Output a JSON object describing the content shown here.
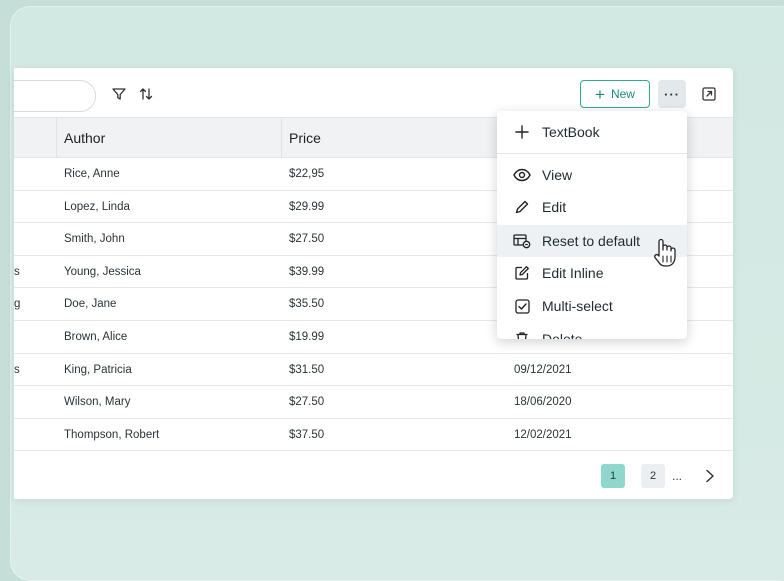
{
  "toolbar": {
    "new_label": "New",
    "more_label": "···"
  },
  "table": {
    "columns": [
      "Author",
      "Price"
    ],
    "rows": [
      {
        "lead": "",
        "author": "Rice, Anne",
        "price": "$22,95",
        "date": ""
      },
      {
        "lead": "",
        "author": "Lopez, Linda",
        "price": "$29.99",
        "date": ""
      },
      {
        "lead": "",
        "author": "Smith, John",
        "price": "$27.50",
        "date": ""
      },
      {
        "lead": "s",
        "author": "Young, Jessica",
        "price": "$39.99",
        "date": ""
      },
      {
        "lead": "g",
        "author": "Doe, Jane",
        "price": "$35.50",
        "date": ""
      },
      {
        "lead": "",
        "author": "Brown, Alice",
        "price": "$19.99",
        "date": ""
      },
      {
        "lead": "s",
        "author": "King, Patricia",
        "price": "$31.50",
        "date": "09/12/2021"
      },
      {
        "lead": "",
        "author": "Wilson, Mary",
        "price": "$27.50",
        "date": "18/06/2020"
      },
      {
        "lead": "",
        "author": "Thompson, Robert",
        "price": "$37.50",
        "date": "12/02/2021"
      }
    ]
  },
  "pagination": {
    "pages": [
      "1",
      "2"
    ],
    "current": "1",
    "ellipsis": "..."
  },
  "menu": {
    "items": [
      {
        "label": "TextBook",
        "icon": "plus-icon"
      },
      {
        "label": "View",
        "icon": "eye-icon"
      },
      {
        "label": "Edit",
        "icon": "pencil-icon"
      },
      {
        "label": "Reset to default",
        "icon": "reset-table-icon"
      },
      {
        "label": "Edit Inline",
        "icon": "edit-inline-icon"
      },
      {
        "label": "Multi-select",
        "icon": "checkbox-icon"
      },
      {
        "label": "Delete",
        "icon": "trash-icon"
      }
    ]
  },
  "colors": {
    "background": "#c5ded7",
    "accent": "#1a8a7d",
    "pager_active": "#8fd7cd"
  }
}
